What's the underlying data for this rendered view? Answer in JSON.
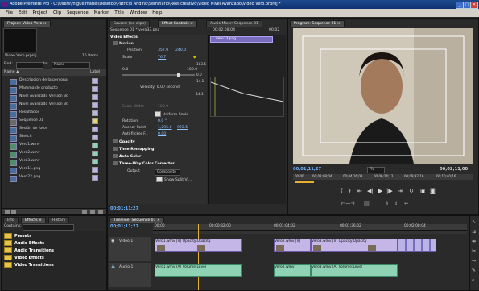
{
  "window": {
    "title": "Adobe Premiere Pro - C:\\Users\\miguelmariel\\Desktop\\Patricio Andino\\Seminario\\Reel creativo\\Video Nivel Avanzado\\Video Vero.prproj *",
    "minimize": "_",
    "maximize": "□",
    "close": "✕"
  },
  "menu": [
    "File",
    "Edit",
    "Project",
    "Clip",
    "Sequence",
    "Marker",
    "Title",
    "Window",
    "Help"
  ],
  "project": {
    "tab": "Project: Video Vero ×",
    "project_name": "Video Vero.prproj",
    "item_count": "15 Items",
    "find_label": "Find:",
    "in_label": "In:",
    "in_value": "Name",
    "col_name": "Name ▲",
    "col_label": "Label",
    "items": [
      {
        "name": "Descripcion de la persona",
        "color": "#b9b3e6"
      },
      {
        "name": "Mamma de producto",
        "color": "#b9b3e6"
      },
      {
        "name": "Nivel Avanzado Versión 3d",
        "color": "#b9b3e6"
      },
      {
        "name": "Nivel Avanzado Version 3d",
        "color": "#b9b3e6"
      },
      {
        "name": "Resultados",
        "color": "#b9b3e6"
      },
      {
        "name": "Sequence 01",
        "color": "#e9d36b"
      },
      {
        "name": "Sesión de fotos",
        "color": "#b9b3e6"
      },
      {
        "name": "Sketch",
        "color": "#b9b3e6"
      },
      {
        "name": "Vero1.wmv",
        "color": "#8fd3b4"
      },
      {
        "name": "Vero2.wmv",
        "color": "#8fd3b4"
      },
      {
        "name": "Vero3.wmv",
        "color": "#8fd3b4"
      },
      {
        "name": "Vero11.png",
        "color": "#b9b3e6"
      },
      {
        "name": "Vero22.png",
        "color": "#b9b3e6"
      }
    ]
  },
  "effect_controls": {
    "tabs": [
      "Source: (no clips)",
      "Effect Controls ×",
      "Audio Mixer: Sequence 01"
    ],
    "sequence_clip": "Sequence 01 * vero33.png",
    "clip_name": "vero33.png",
    "timecode_top": "00;02;08;04",
    "timecode_right": "00;02",
    "section_video": "Video Effects",
    "motion": "Motion",
    "position_label": "Position",
    "position_x": "357.0",
    "position_y": "240.0",
    "scale_label": "Scale",
    "scale_value": "76.7",
    "scale_max": "100.0",
    "scale_min": "0.0",
    "graph_v1": "103.5",
    "graph_v2": "0.0",
    "graph_v3": "14.1",
    "graph_v4": "-14.1",
    "velocity": "Velocity: 0.0 / second",
    "scale_width": "Scale Width",
    "scale_width_val": "100.0",
    "uniform_scale": "Uniform Scale",
    "rotation_label": "Rotation",
    "rotation_value": "0.0 °",
    "anchor_label": "Anchor Point",
    "anchor_x": "1,295.0",
    "anchor_y": "972.5",
    "antiflicker_label": "Anti-flicker F...",
    "antiflicker_value": "0.00",
    "opacity": "Opacity",
    "time_remapping": "Time Remapping",
    "auto_color": "Auto Color",
    "three_way": "Three-Way Color Corrector",
    "output_label": "Output",
    "output_value": "Composite",
    "show_split": "Show Split Vi...",
    "bottom_timecode": "00;01;11;27"
  },
  "program": {
    "tab": "Program: Sequence 01 ×",
    "timecode_left": "00;01;11;27",
    "fit": "Fit",
    "timecode_right": "00;02;11;00",
    "ruler": [
      "00;00",
      "00;02;08;04",
      "00;04;16;08",
      "00;06;24;12",
      "00;08;32;16",
      "00;10;40;16"
    ]
  },
  "effects_panel": {
    "tabs": [
      "Info",
      "Effects ×",
      "History"
    ],
    "contains": "Contains:",
    "folders": [
      "Presets",
      "Audio Effects",
      "Audio Transitions",
      "Video Effects",
      "Video Transitions"
    ]
  },
  "timeline": {
    "tab": "Timeline: Sequence 01 ×",
    "timecode": "00;01;11;27",
    "ruler": [
      "00;00",
      "00;00;32;00",
      "00;01;04;02",
      "00;01;36;02",
      "00;02;08;04"
    ],
    "video_track": "Video 1",
    "audio_track": "Audio 1",
    "video_clips": [
      {
        "label": "Vero1.wmv [V] Opacity:Opacity"
      },
      {
        "label": "Vero2.wmv [V]"
      },
      {
        "label": "Vero3.wmv [V] Opacity:Opacity"
      }
    ],
    "audio_clips": [
      {
        "label": "Vero1.wmv [A] Volume:Level"
      },
      {
        "label": "Vero2.wmv"
      },
      {
        "label": "Vero3.wmv [A] Volume:Level"
      }
    ]
  }
}
